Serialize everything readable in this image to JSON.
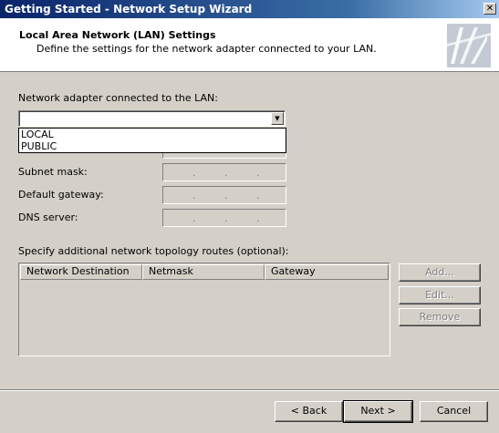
{
  "window": {
    "title": "Getting Started - Network Setup Wizard",
    "close_glyph": "✕"
  },
  "header": {
    "title": "Local Area Network (LAN) Settings",
    "subtitle": "Define the settings for the network adapter connected to your LAN."
  },
  "adapter": {
    "label": "Network adapter connected to the LAN:",
    "value": "",
    "options": [
      "LOCAL",
      "PUBLIC"
    ],
    "arrow_glyph": "▼"
  },
  "fields": {
    "subnet_label": "Subnet mask:",
    "gateway_label": "Default gateway:",
    "dns_label": "DNS server:",
    "ip_dot": "."
  },
  "routes": {
    "label": "Specify additional network topology routes (optional):",
    "columns": [
      "Network Destination",
      "Netmask",
      "Gateway"
    ],
    "rows": [],
    "add_label": "Add...",
    "edit_label": "Edit...",
    "remove_label": "Remove"
  },
  "nav": {
    "back_label": "< Back",
    "next_label": "Next >",
    "cancel_label": "Cancel"
  }
}
